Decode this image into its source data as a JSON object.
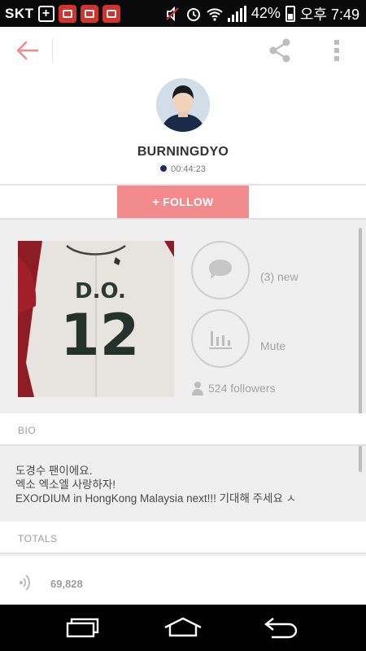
{
  "status_bar": {
    "carrier": "SKT",
    "battery": "42%",
    "time": "오후 7:49"
  },
  "profile": {
    "username": "BURNINGDYO",
    "live_time": "00:44:23",
    "follow_label": "+ FOLLOW"
  },
  "stats": {
    "messages_label": "(3) new",
    "mute_label": "Mute",
    "followers_label": "524 followers"
  },
  "bio": {
    "heading": "BIO",
    "lines": [
      "도경수 팬이에요.",
      "엑소 엑소엘 사랑하자!",
      "EXOrDIUM in HongKong    Malaysia    next!!! 기대해 주세요 ㅅ"
    ]
  },
  "totals": {
    "heading": "TOTALS",
    "plays": "69,828"
  },
  "icons": {
    "back": "back-arrow-icon",
    "share": "share-icon",
    "more": "more-vert-icon",
    "message": "chat-bubble-icon",
    "mute": "equalizer-icon",
    "followers": "person-icon",
    "plays": "broadcast-icon"
  },
  "colors": {
    "accent": "#f28b8e",
    "status_dot": "#1d2b6b"
  }
}
